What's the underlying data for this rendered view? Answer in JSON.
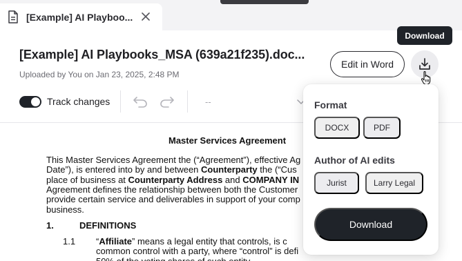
{
  "tab": {
    "title": "[Example] AI Playboo...",
    "icon": "document-icon",
    "close_icon": "close-icon"
  },
  "header": {
    "title": "[Example] AI Playbooks_MSA (639a21f235).doc...",
    "meta": "Uploaded by You on Jan 23, 2025, 2:48 PM",
    "edit_in_word": "Edit in Word",
    "download_icon": "download-icon",
    "tooltip": "Download"
  },
  "toolbar": {
    "track_changes_label": "Track changes",
    "track_changes_on": true,
    "select_value": "--",
    "undo_icon": "undo-icon",
    "redo_icon": "redo-icon"
  },
  "document": {
    "heading": "Master Services Agreement",
    "paragraph_lines": [
      [
        {
          "t": "This Master Services Agreement the (“Agreement”), effective Ag",
          "b": false
        }
      ],
      [
        {
          "t": "Date”), is entered into by and between ",
          "b": false
        },
        {
          "t": "Counterparty",
          "b": true
        },
        {
          "t": " the (“Cus",
          "b": false
        }
      ],
      [
        {
          "t": "place of business at ",
          "b": false
        },
        {
          "t": "Counterparty Address",
          "b": true
        },
        {
          "t": " and ",
          "b": false
        },
        {
          "t": "COMPANY IN",
          "b": true
        }
      ],
      [
        {
          "t": "Agreement defines the relationship between both the Customer",
          "b": false
        }
      ],
      [
        {
          "t": "provide certain service and deliverables in support of your comp",
          "b": false
        }
      ],
      [
        {
          "t": "business.",
          "b": false
        }
      ]
    ],
    "section_number": "1.",
    "section_title": "DEFINITIONS",
    "subsection_number": "1.1",
    "subsection_lines": [
      [
        {
          "t": "“",
          "b": false
        },
        {
          "t": "Affiliate",
          "b": true
        },
        {
          "t": "” means a legal entity that controls, is c",
          "b": false
        }
      ],
      [
        {
          "t": "common control with a party, where “control” is defi",
          "b": false
        }
      ],
      [
        {
          "t": "50% of the voting shares of such entity.",
          "b": false
        }
      ]
    ]
  },
  "download_popover": {
    "format_label": "Format",
    "format_options": [
      "DOCX",
      "PDF"
    ],
    "format_selected": "PDF",
    "author_label": "Author of AI edits",
    "author_options": [
      "Jurist",
      "Larry Legal"
    ],
    "author_selected": "Jurist",
    "download_label": "Download"
  },
  "colors": {
    "primary_dark": "#1f2329",
    "chip_selected": "#ececef",
    "tab_strip": "#f3f3f5"
  }
}
